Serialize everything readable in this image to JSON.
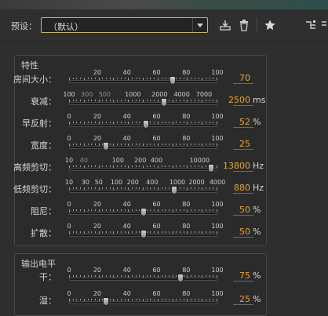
{
  "toolbar": {
    "preset_label": "预设：",
    "preset_value": "（默认）",
    "icons": [
      "save-preset-icon",
      "delete-preset-icon",
      "favorite-star-icon",
      "routing-icon"
    ]
  },
  "characteristics": {
    "title": "特性",
    "controls": [
      {
        "key": "room_size",
        "label": "房间大小：",
        "ticks": [
          "20",
          "40",
          "60",
          "80",
          "100"
        ],
        "dim_ticks": [],
        "value": "70",
        "unit": "",
        "fraction": 0.7
      },
      {
        "key": "decay",
        "label": "衰减：",
        "ticks": [
          "100",
          "1000",
          "2000",
          "4000",
          "7000"
        ],
        "dim_ticks": [
          "300",
          "500"
        ],
        "value": "2500",
        "unit": "ms",
        "fraction": 0.64
      },
      {
        "key": "early_reflections",
        "label": "早反射：",
        "ticks": [
          "0",
          "20",
          "40",
          "60",
          "80",
          "100"
        ],
        "dim_ticks": [],
        "value": "52",
        "unit": "%",
        "fraction": 0.52
      },
      {
        "key": "width",
        "label": "宽度：",
        "ticks": [
          "0",
          "20",
          "40",
          "60",
          "80",
          "100"
        ],
        "dim_ticks": [],
        "value": "25",
        "unit": "",
        "fraction": 0.25
      },
      {
        "key": "high_cut",
        "label": "高频剪切：",
        "ticks": [
          "10",
          "100",
          "200",
          "400",
          "10000"
        ],
        "dim_ticks": [
          "40"
        ],
        "value": "13800",
        "unit": "Hz",
        "fraction": 0.96
      },
      {
        "key": "low_cut",
        "label": "低频剪切：",
        "ticks": [
          "10",
          "30",
          "50",
          "100",
          "200",
          "400",
          "1000",
          "2000",
          "4000"
        ],
        "dim_ticks": [],
        "value": "880",
        "unit": "Hz",
        "fraction": 0.71
      },
      {
        "key": "damping",
        "label": "阻尼：",
        "ticks": [
          "0",
          "20",
          "40",
          "60",
          "80",
          "100"
        ],
        "dim_ticks": [],
        "value": "50",
        "unit": "%",
        "fraction": 0.5
      },
      {
        "key": "diffusion",
        "label": "扩散：",
        "ticks": [
          "0",
          "20",
          "40",
          "60",
          "80",
          "100"
        ],
        "dim_ticks": [],
        "value": "50",
        "unit": "%",
        "fraction": 0.5
      }
    ]
  },
  "output_level": {
    "title": "输出电平",
    "controls": [
      {
        "key": "dry",
        "label": "干：",
        "ticks": [
          "0",
          "20",
          "40",
          "60",
          "80",
          "100"
        ],
        "dim_ticks": [],
        "value": "75",
        "unit": "%",
        "fraction": 0.75
      },
      {
        "key": "wet",
        "label": "湿：",
        "ticks": [
          "0",
          "20",
          "40",
          "60",
          "80",
          "100"
        ],
        "dim_ticks": [],
        "value": "25",
        "unit": "%",
        "fraction": 0.25
      }
    ]
  }
}
